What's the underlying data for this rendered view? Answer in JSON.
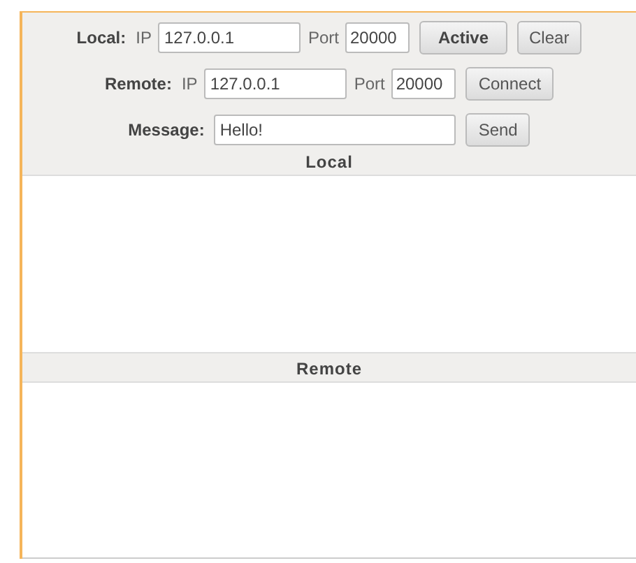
{
  "controls": [
    {
      "kind": "address",
      "label": "Local:",
      "ip_label": "IP",
      "ip": "127.0.0.1",
      "port_label": "Port",
      "port": "20000",
      "buttons": [
        {
          "label": "Active",
          "bold": true
        },
        {
          "label": "Clear",
          "bold": false
        }
      ]
    },
    {
      "kind": "address",
      "label": "Remote:",
      "ip_label": "IP",
      "ip": "127.0.0.1",
      "port_label": "Port",
      "port": "20000",
      "buttons": [
        {
          "label": "Connect",
          "bold": false
        }
      ]
    },
    {
      "kind": "message",
      "label": "Message:",
      "value": "Hello!",
      "buttons": [
        {
          "label": "Send",
          "bold": false
        }
      ]
    }
  ],
  "panels": [
    {
      "title": "Local"
    },
    {
      "title": "Remote"
    }
  ]
}
